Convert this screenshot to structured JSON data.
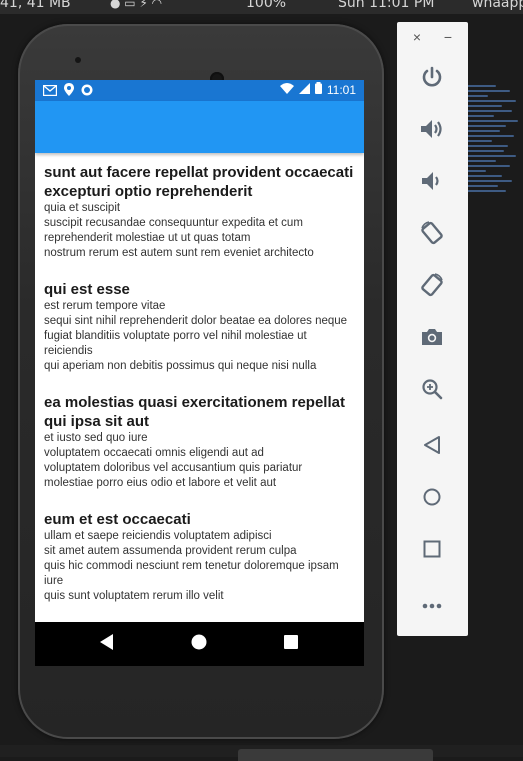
{
  "system_bar": {
    "left_text": "41, 41 MB",
    "battery_text": "100%",
    "clock_text": "Sun 11:01 PM",
    "app_text": "whaapp"
  },
  "phone": {
    "status_bar": {
      "time": "11:01",
      "icons": [
        "gmail-icon",
        "location-icon",
        "sync-icon",
        "wifi-icon",
        "signal-icon",
        "battery-icon"
      ]
    },
    "posts": [
      {
        "title": "sunt aut facere repellat provident occaecati excepturi optio reprehenderit",
        "body": "quia et suscipit\nsuscipit recusandae consequuntur expedita et cum reprehenderit molestiae ut ut quas totam\nnostrum rerum est autem sunt rem eveniet architecto"
      },
      {
        "title": "qui est esse",
        "body": "est rerum tempore vitae\nsequi sint nihil reprehenderit dolor beatae ea dolores neque\nfugiat blanditiis voluptate porro vel nihil molestiae ut reiciendis\nqui aperiam non debitis possimus qui neque nisi nulla"
      },
      {
        "title": "ea molestias quasi exercitationem repellat qui ipsa sit aut",
        "body": "et iusto sed quo iure\nvoluptatem occaecati omnis eligendi aut ad\nvoluptatem doloribus vel accusantium quis pariatur\nmolestiae porro eius odio et labore et velit aut"
      },
      {
        "title": "eum et est occaecati",
        "body": "ullam et saepe reiciendis voluptatem adipisci\nsit amet autem assumenda provident rerum culpa\nquis hic commodi nesciunt rem tenetur doloremque ipsam iure\nquis sunt voluptatem rerum illo velit"
      }
    ],
    "nav_buttons": [
      "back-nav",
      "home-nav",
      "recents-nav"
    ]
  },
  "emulator_panel": {
    "close_label": "×",
    "minimize_label": "−",
    "tools": [
      "power",
      "volume-up",
      "volume-down",
      "rotate-left",
      "rotate-right",
      "screenshot",
      "zoom",
      "back",
      "home",
      "overview",
      "more"
    ]
  },
  "colors": {
    "status_bar": "#1976d2",
    "app_bar": "#2196f3",
    "panel_bg": "#f5f5f5",
    "panel_icon": "#5f6a77"
  }
}
